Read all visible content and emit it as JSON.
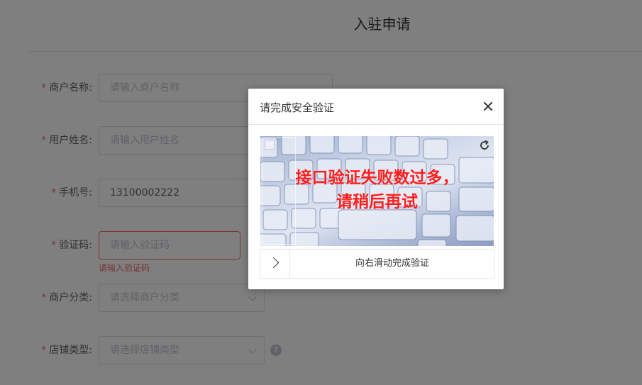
{
  "page": {
    "title": "入驻申请"
  },
  "form": {
    "required_mark": "*",
    "merchant_name": {
      "label": "商户名称:",
      "placeholder": "请输入商户名称"
    },
    "user_name": {
      "label": "用户姓名:",
      "placeholder": "请输入用户姓名"
    },
    "phone": {
      "label": "手机号:",
      "value": "13100002222"
    },
    "verify_code": {
      "label": "验证码:",
      "placeholder": "请输入验证码",
      "error": "请输入验证码"
    },
    "merchant_category": {
      "label": "商户分类:",
      "placeholder": "请选择商户分类"
    },
    "store_type": {
      "label": "店铺类型:",
      "placeholder": "请选择店铺类型",
      "help_icon": "?"
    }
  },
  "captcha_dialog": {
    "title": "请完成安全验证",
    "error_line1": "接口验证失败数过多，",
    "error_line2": "请稍后再试",
    "slider_text": "向右滑动完成验证",
    "icons": [
      "close-icon",
      "refresh-icon",
      "chevron-right-icon",
      "broken-image-icon"
    ]
  },
  "colors": {
    "required": "#f56c6c",
    "error": "#f56c6c",
    "captcha_error_text": "#ff1f1f",
    "overlay": "rgba(0,0,0,0.5)"
  }
}
